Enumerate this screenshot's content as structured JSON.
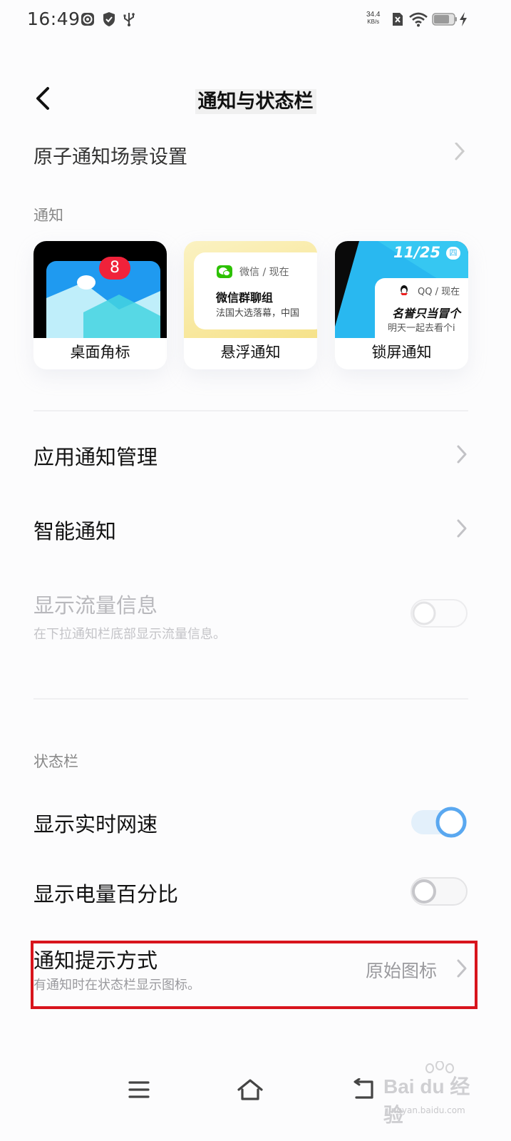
{
  "status_bar": {
    "time": "16:49",
    "net_speed_value": "34.4",
    "net_speed_unit": "KB/s",
    "icons": [
      "target-icon",
      "shield-icon",
      "usb-icon",
      "no-sim-icon",
      "wifi-icon",
      "battery-icon",
      "charging-bolt-icon"
    ]
  },
  "header": {
    "title": "通知与状态栏",
    "back_icon": "back-arrow-icon"
  },
  "clipped_row": {
    "label": "原子通知场景设置"
  },
  "notifications_section": {
    "label": "通知",
    "cards": [
      {
        "caption": "桌面角标",
        "badge_count": "8"
      },
      {
        "caption": "悬浮通知",
        "app_line": "微信 / 现在",
        "title": "微信群聊组",
        "body": "法国大选落幕，中国"
      },
      {
        "caption": "锁屏通知",
        "date": "11/25",
        "weekday": "四",
        "app_line": "QQ / 现在",
        "title": "名誉只当冒个",
        "body": "明天一起去看个i"
      }
    ]
  },
  "rows": {
    "app_notification_mgmt": {
      "title": "应用通知管理"
    },
    "smart_notification": {
      "title": "智能通知"
    },
    "show_traffic_info": {
      "title": "显示流量信息",
      "subtitle": "在下拉通知栏底部显示流量信息。",
      "enabled": false,
      "disabled": true
    }
  },
  "status_bar_section": {
    "label": "状态栏",
    "show_net_speed": {
      "title": "显示实时网速",
      "enabled": true
    },
    "show_battery_percent": {
      "title": "显示电量百分比",
      "enabled": false
    },
    "notification_style": {
      "title": "通知提示方式",
      "subtitle": "有通知时在状态栏显示图标。",
      "value": "原始图标"
    }
  },
  "nav_bar": {
    "icons": [
      "menu-icon",
      "home-icon",
      "back-icon"
    ]
  },
  "watermark": {
    "brand": "Bai du 经验",
    "sub": "jingyan.baidu.com"
  },
  "colors": {
    "accent": "#5aa8f0",
    "highlight": "#d8141c",
    "wechat_green": "#2dc100"
  }
}
